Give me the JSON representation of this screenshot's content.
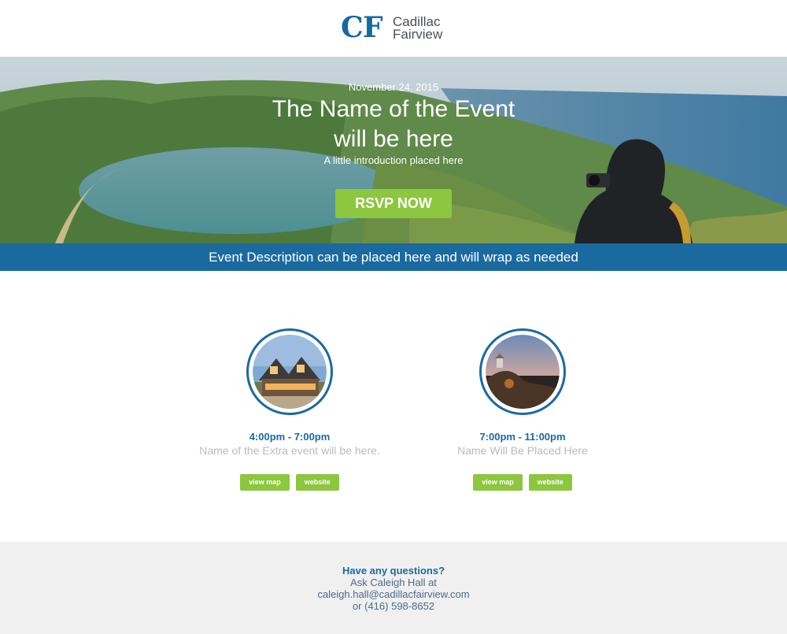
{
  "logo": {
    "mark": "CF",
    "line1": "Cadillac",
    "line2": "Fairview",
    "color": "#146aa0"
  },
  "hero": {
    "date": "November 24, 2015",
    "title_line1": "The Name of the Event",
    "title_line2": "will be here",
    "intro": "A little introduction placed here",
    "rsvp_label": "RSVP NOW"
  },
  "description": "Event Description can be placed here and will wrap as needed",
  "events": [
    {
      "time": "4:00pm - 7:00pm",
      "name": "Name of the Extra event will be here.",
      "map_label": "view map",
      "website_label": "website",
      "image_icon": "house-photo"
    },
    {
      "time": "7:00pm - 11:00pm",
      "name": "Name Will Be Placed Here",
      "map_label": "view map",
      "website_label": "website",
      "image_icon": "sunset-cliff-photo"
    }
  ],
  "footer": {
    "question": "Have any questions?",
    "line1": "Ask Caleigh Hall at",
    "line2": "caleigh.hall@cadillacfairview.com",
    "line3": "or (416) 598-8652"
  },
  "colors": {
    "brand_blue": "#1a6aa0",
    "accent_green": "#8dc63f",
    "footer_bg": "#f0f0f0"
  }
}
